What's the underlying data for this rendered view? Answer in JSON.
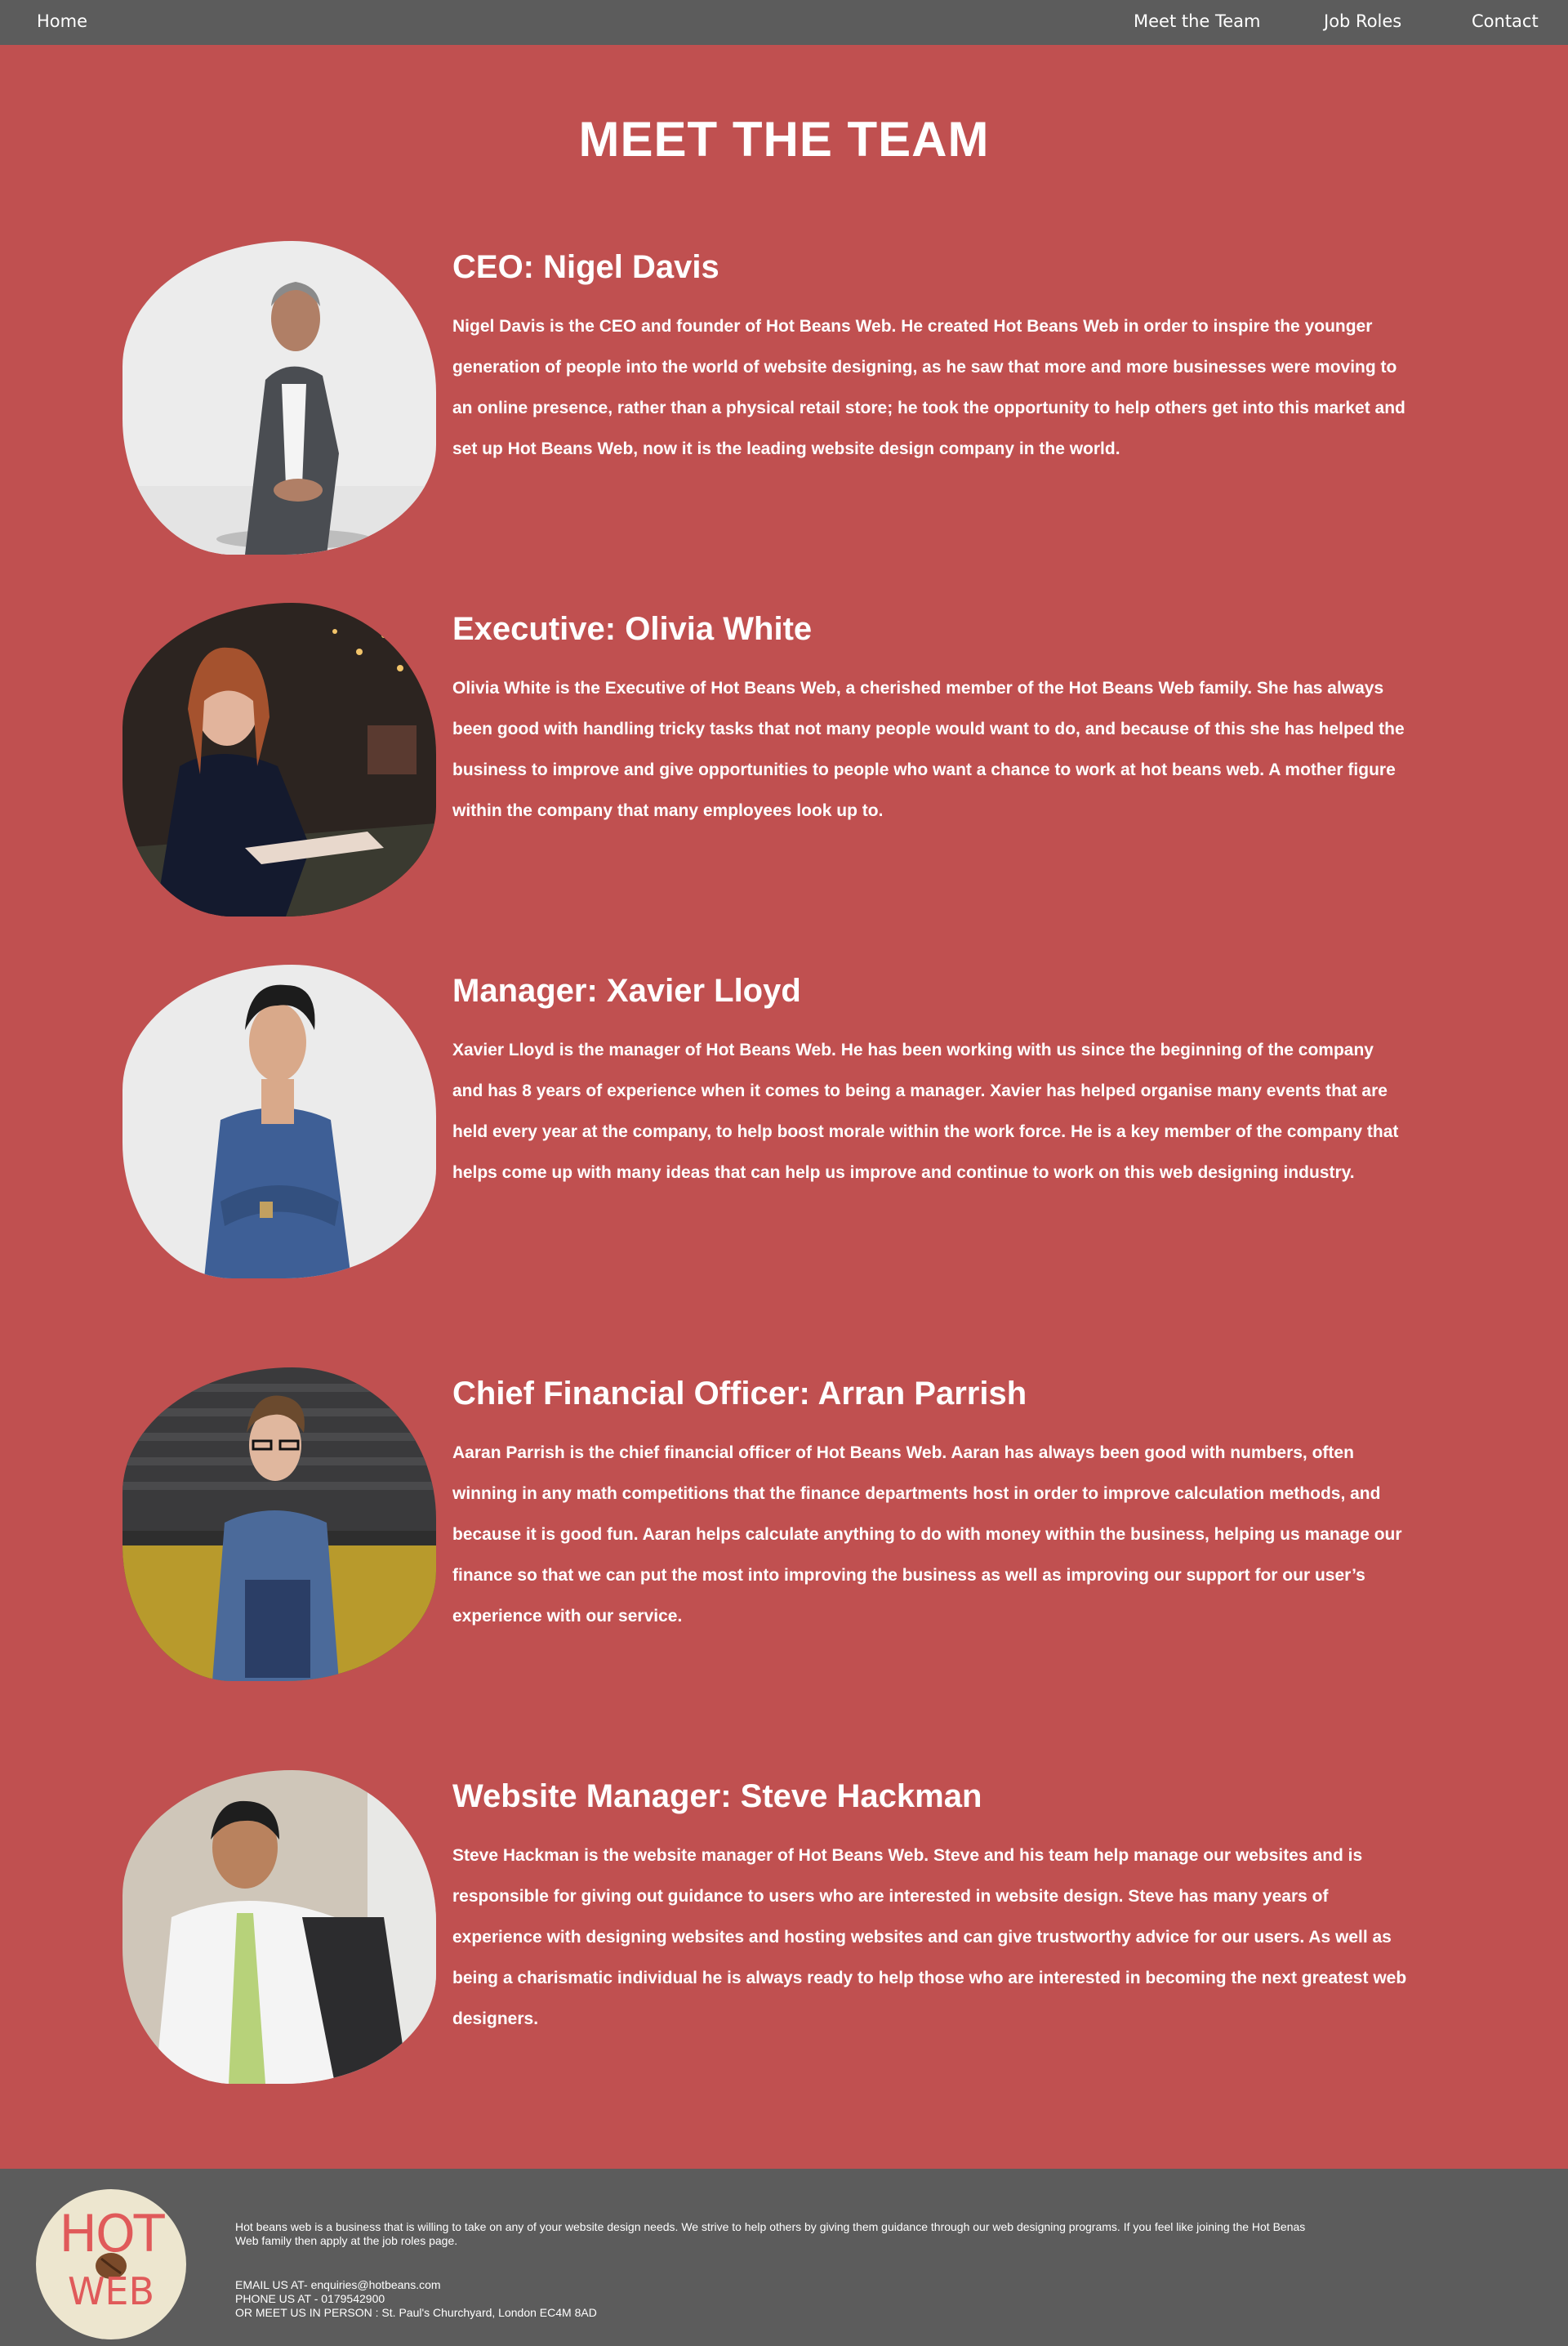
{
  "nav": {
    "home": "Home",
    "meet_team": "Meet the Team",
    "job_roles": "Job Roles",
    "contact": "Contact"
  },
  "page_title": "MEET THE TEAM",
  "members": [
    {
      "role_name": "CEO: Nigel Davis",
      "bio": "Nigel Davis is the CEO and founder of Hot Beans Web. He created Hot Beans Web in order to inspire the younger generation of people into the world of website designing, as he saw that more and more businesses were moving to an online presence, rather than a physical retail store; he took the opportunity to help others get into this market and set up Hot Beans Web, now it is the leading website design company in the world."
    },
    {
      "role_name": "Executive: Olivia White",
      "bio": "Olivia White is the Executive of Hot Beans Web, a cherished member of the Hot Beans Web family. She has always been good with handling tricky tasks that not many people would want to do, and because of this she has helped the business to improve and give opportunities to people who want a chance to work at hot beans web. A mother figure within the company that many employees look up to."
    },
    {
      "role_name": "Manager: Xavier Lloyd",
      "bio": "Xavier Lloyd is the manager of Hot Beans Web. He has been working with us since the beginning of the company and has 8 years of experience when it comes to being a manager. Xavier has helped organise many events that are held every year at the company, to help boost morale within the work force. He is a key member of the company that helps come up with many ideas that can help us improve and continue to work on this web designing industry."
    },
    {
      "role_name": "Chief Financial Officer: Arran Parrish",
      "bio": "Aaran Parrish is the chief financial officer of Hot Beans Web. Aaran has always been good with numbers, often winning in any math competitions that the finance departments host in order to improve calculation methods, and because it is good fun. Aaran helps calculate anything to do with money within the business, helping us manage our finance so that we can put the most into improving the business as well as improving our support for our user’s experience with our service."
    },
    {
      "role_name": "Website Manager: Steve Hackman",
      "bio": "Steve Hackman is the website manager of Hot Beans Web. Steve and his team help manage our websites and is responsible for giving out guidance to users who are interested in website design. Steve has many years of experience with designing websites and hosting websites and can give trustworthy advice for our users. As well as being a charismatic individual he is always ready to help those who are interested in becoming the next greatest web designers."
    }
  ],
  "footer": {
    "logo_top": "HOT",
    "logo_bottom": "WEB",
    "about": "Hot beans web is a business that is willing to take on any of your website design needs. We strive to help others by giving them guidance through our web designing programs. If you feel like joining the Hot Benas Web family then apply at the job roles page.",
    "email": "EMAIL US AT- enquiries@hotbeans.com",
    "phone": "PHONE US AT - 0179542900",
    "address": "OR MEET US IN PERSON : St. Paul's Churchyard, London EC4M 8AD"
  },
  "colors": {
    "background": "#c05050",
    "bars": "#5c5c5c",
    "text": "#ffffff",
    "logo_bg": "#ede6cf",
    "logo_text": "#e05a5a"
  }
}
